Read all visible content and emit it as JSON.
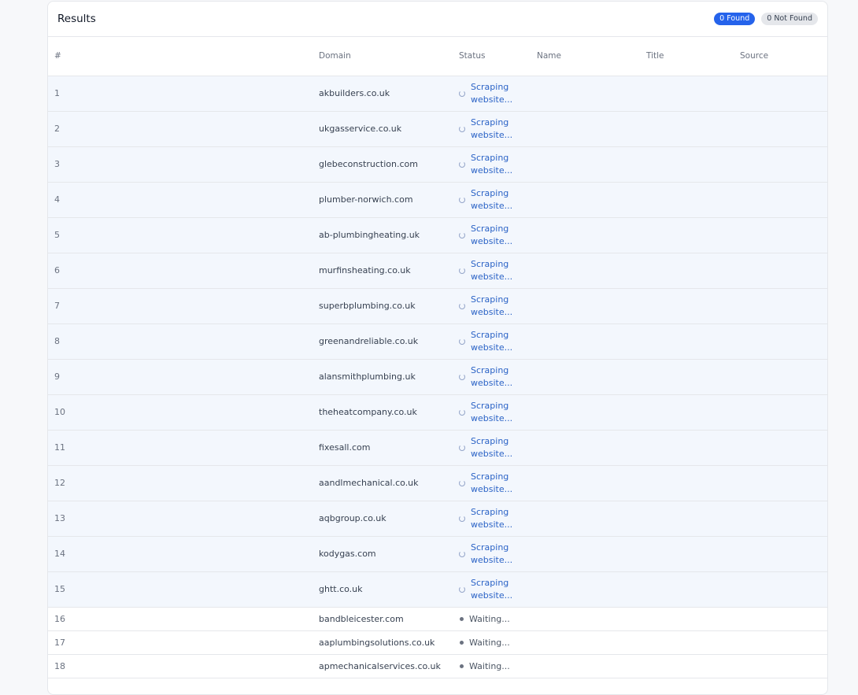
{
  "header": {
    "title": "Results",
    "found_badge": "0 Found",
    "not_found_badge": "0 Not Found"
  },
  "columns": {
    "num": "#",
    "domain": "Domain",
    "status": "Status",
    "name": "Name",
    "title": "Title",
    "source": "Source"
  },
  "status_labels": {
    "scraping_line1": "Scraping",
    "scraping_line2": "website...",
    "waiting": "Waiting..."
  },
  "rows": [
    {
      "num": "1",
      "domain": "akbuilders.co.uk",
      "state": "scraping"
    },
    {
      "num": "2",
      "domain": "ukgasservice.co.uk",
      "state": "scraping"
    },
    {
      "num": "3",
      "domain": "glebeconstruction.com",
      "state": "scraping"
    },
    {
      "num": "4",
      "domain": "plumber-norwich.com",
      "state": "scraping"
    },
    {
      "num": "5",
      "domain": "ab-plumbingheating.uk",
      "state": "scraping"
    },
    {
      "num": "6",
      "domain": "murfinsheating.co.uk",
      "state": "scraping"
    },
    {
      "num": "7",
      "domain": "superbplumbing.co.uk",
      "state": "scraping"
    },
    {
      "num": "8",
      "domain": "greenandreliable.co.uk",
      "state": "scraping"
    },
    {
      "num": "9",
      "domain": "alansmithplumbing.uk",
      "state": "scraping"
    },
    {
      "num": "10",
      "domain": "theheatcompany.co.uk",
      "state": "scraping"
    },
    {
      "num": "11",
      "domain": "fixesall.com",
      "state": "scraping"
    },
    {
      "num": "12",
      "domain": "aandlmechanical.co.uk",
      "state": "scraping"
    },
    {
      "num": "13",
      "domain": "aqbgroup.co.uk",
      "state": "scraping"
    },
    {
      "num": "14",
      "domain": "kodygas.com",
      "state": "scraping"
    },
    {
      "num": "15",
      "domain": "ghtt.co.uk",
      "state": "scraping"
    },
    {
      "num": "16",
      "domain": "bandbleicester.com",
      "state": "waiting"
    },
    {
      "num": "17",
      "domain": "aaplumbingsolutions.co.uk",
      "state": "waiting"
    },
    {
      "num": "18",
      "domain": "apmechanicalservices.co.uk",
      "state": "waiting"
    }
  ],
  "colors": {
    "accent": "#2563eb",
    "status_link": "#2b63c6",
    "active_row_bg": "#f3f7fd"
  },
  "icons": {
    "scraping": "spinner-icon",
    "waiting": "dot-icon"
  }
}
